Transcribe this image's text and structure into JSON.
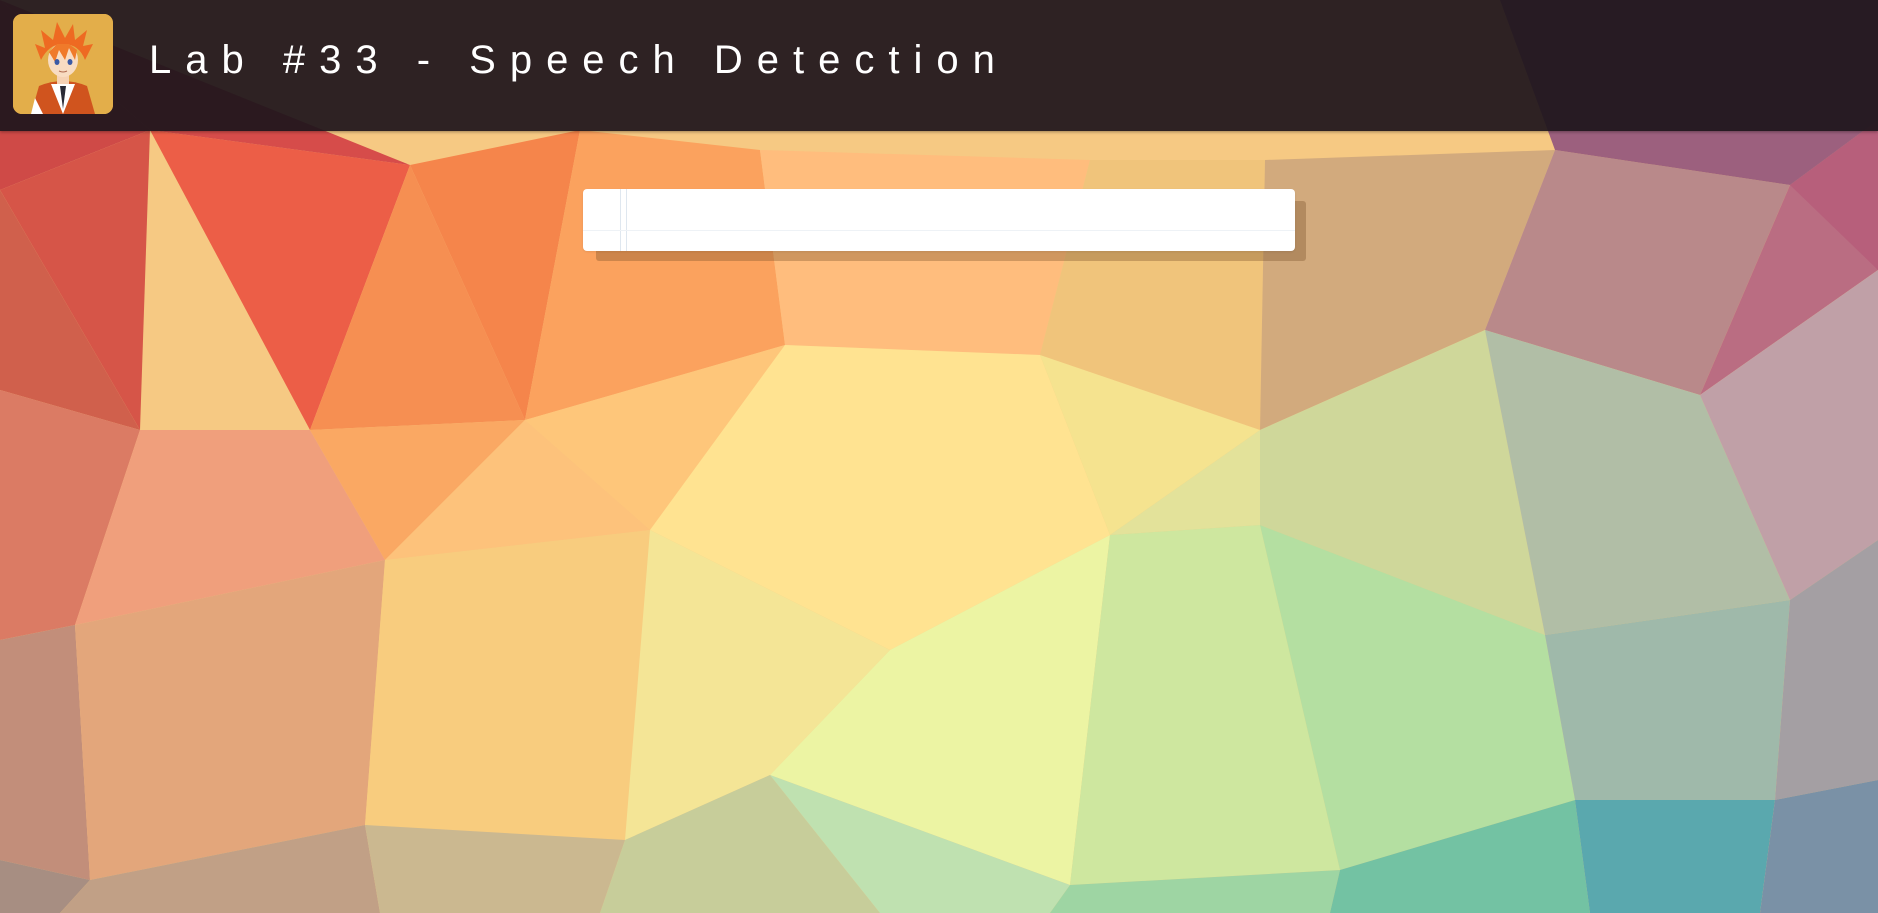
{
  "header": {
    "title": "Lab #33 - Speech Detection",
    "avatar_icon": "anime-character-avatar-icon"
  },
  "transcript": {
    "paragraphs": [
      ""
    ]
  },
  "colors": {
    "header_bg": "#1e161c",
    "avatar_bg": "#e3ae4a",
    "paper_bg": "#ffffff",
    "title_text": "#ffffff"
  }
}
